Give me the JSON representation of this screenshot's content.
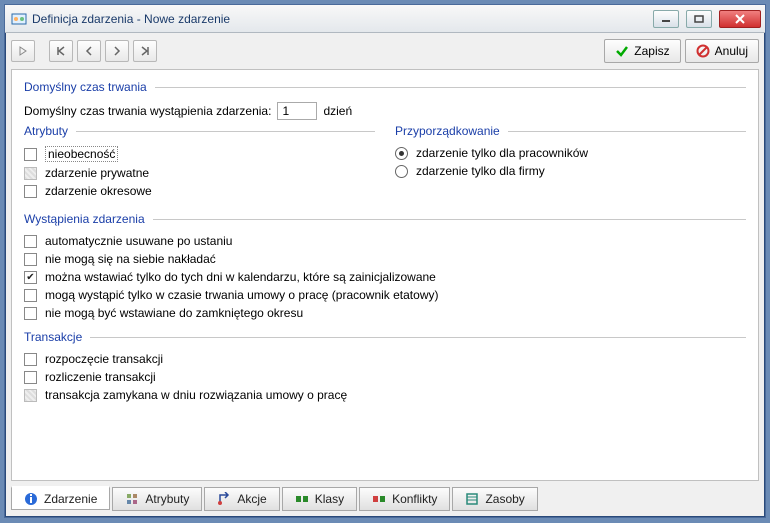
{
  "window": {
    "title": "Definicja zdarzenia - Nowe zdarzenie"
  },
  "toolbar": {
    "save": "Zapisz",
    "cancel": "Anuluj"
  },
  "sections": {
    "default_duration": {
      "header": "Domyślny czas trwania",
      "label": "Domyślny czas trwania wystąpienia zdarzenia:",
      "value": "1",
      "unit": "dzień"
    },
    "attributes": {
      "header": "Atrybuty",
      "items": {
        "absence": "nieobecność",
        "private": "zdarzenie prywatne",
        "periodic": "zdarzenie okresowe"
      }
    },
    "assignment": {
      "header": "Przyporządkowanie",
      "radio_employees": "zdarzenie tylko dla pracowników",
      "radio_company": "zdarzenie tylko dla firmy"
    },
    "occurrences": {
      "header": "Wystąpienia zdarzenia",
      "auto_remove": "automatycznie usuwane po ustaniu",
      "no_overlap": "nie mogą się na siebie nakładać",
      "calendar_initialized": "można wstawiać tylko do tych dni w kalendarzu, które są zainicjalizowane",
      "during_contract": "mogą wystąpić tylko w czasie trwania umowy o pracę (pracownik etatowy)",
      "no_closed_period": "nie mogą być wstawiane do zamkniętego okresu"
    },
    "transactions": {
      "header": "Transakcje",
      "start": "rozpoczęcie transakcji",
      "settlement": "rozliczenie transakcji",
      "closed_on_termination": "transakcja zamykana w dniu rozwiązania umowy o pracę"
    }
  },
  "tabs": {
    "event": "Zdarzenie",
    "attributes": "Atrybuty",
    "actions": "Akcje",
    "classes": "Klasy",
    "conflicts": "Konflikty",
    "resources": "Zasoby"
  }
}
